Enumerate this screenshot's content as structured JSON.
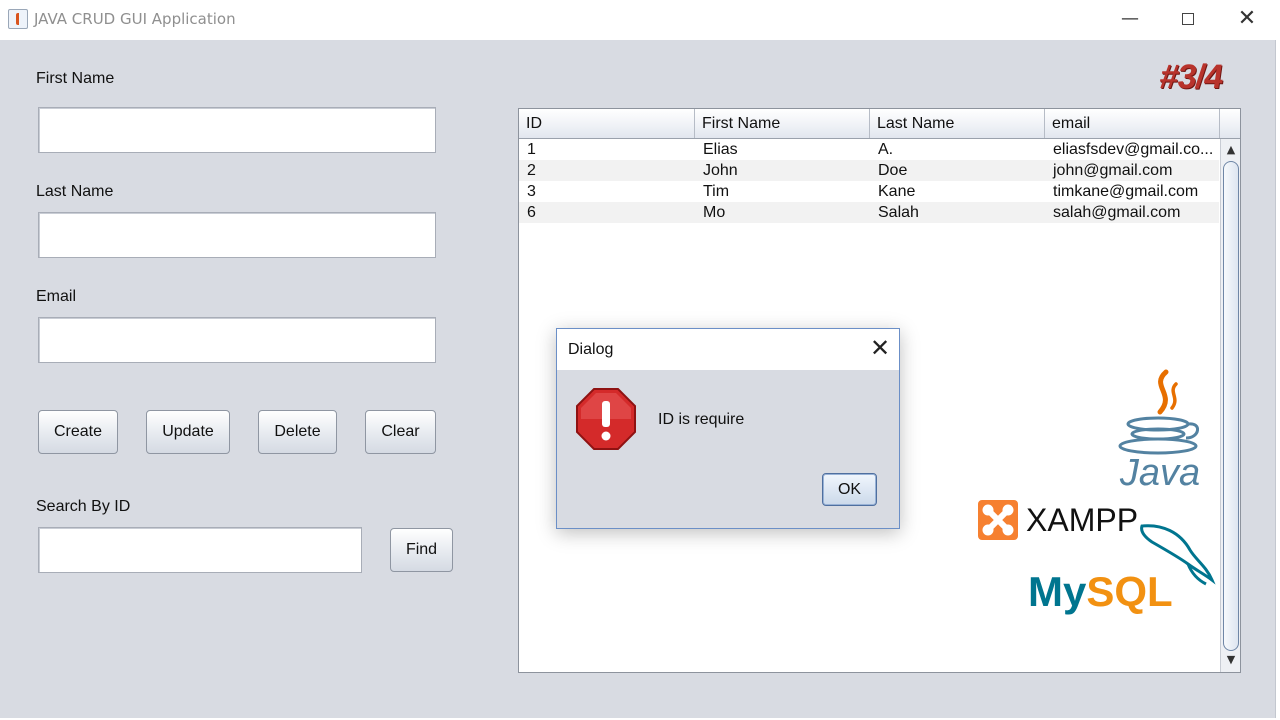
{
  "window": {
    "title": "JAVA CRUD GUI Application",
    "minimize_glyph": "—",
    "close_glyph": "✕"
  },
  "form": {
    "first_name_label": "First Name",
    "first_name_value": "",
    "last_name_label": "Last Name",
    "last_name_value": "",
    "email_label": "Email",
    "email_value": "",
    "search_label": "Search By ID",
    "search_value": ""
  },
  "buttons": {
    "create": "Create",
    "update": "Update",
    "delete": "Delete",
    "clear": "Clear",
    "find": "Find"
  },
  "table": {
    "columns": [
      "ID",
      "First Name",
      "Last Name",
      "email"
    ],
    "rows": [
      [
        "1",
        "Elias",
        "A.",
        "eliasfsdev@gmail.co..."
      ],
      [
        "2",
        "John",
        "Doe",
        "john@gmail.com"
      ],
      [
        "3",
        "Tim",
        "Kane",
        "timkane@gmail.com"
      ],
      [
        "6",
        "Mo",
        "Salah",
        "salah@gmail.com"
      ]
    ],
    "scroll_up_glyph": "▲",
    "scroll_down_glyph": "▼"
  },
  "dialog": {
    "title": "Dialog",
    "close_glyph": "✕",
    "message": "ID is require",
    "ok_label": "OK",
    "icon": "error-stop-icon"
  },
  "overlay": {
    "episode": "#3/4",
    "java_logo_text": "Java",
    "xampp_text": "XAMPP",
    "mysql_my": "My",
    "mysql_sql": "SQL"
  },
  "colors": {
    "client_bg": "#d8dbe2",
    "dialog_border": "#6b8fc7",
    "stop_red": "#d42a2a",
    "episode_red": "#b8332c",
    "java_blue": "#5382a1",
    "java_orange": "#e76f00",
    "xampp_orange": "#f68030",
    "mysql_blue": "#00758f",
    "mysql_orange": "#f29111"
  }
}
